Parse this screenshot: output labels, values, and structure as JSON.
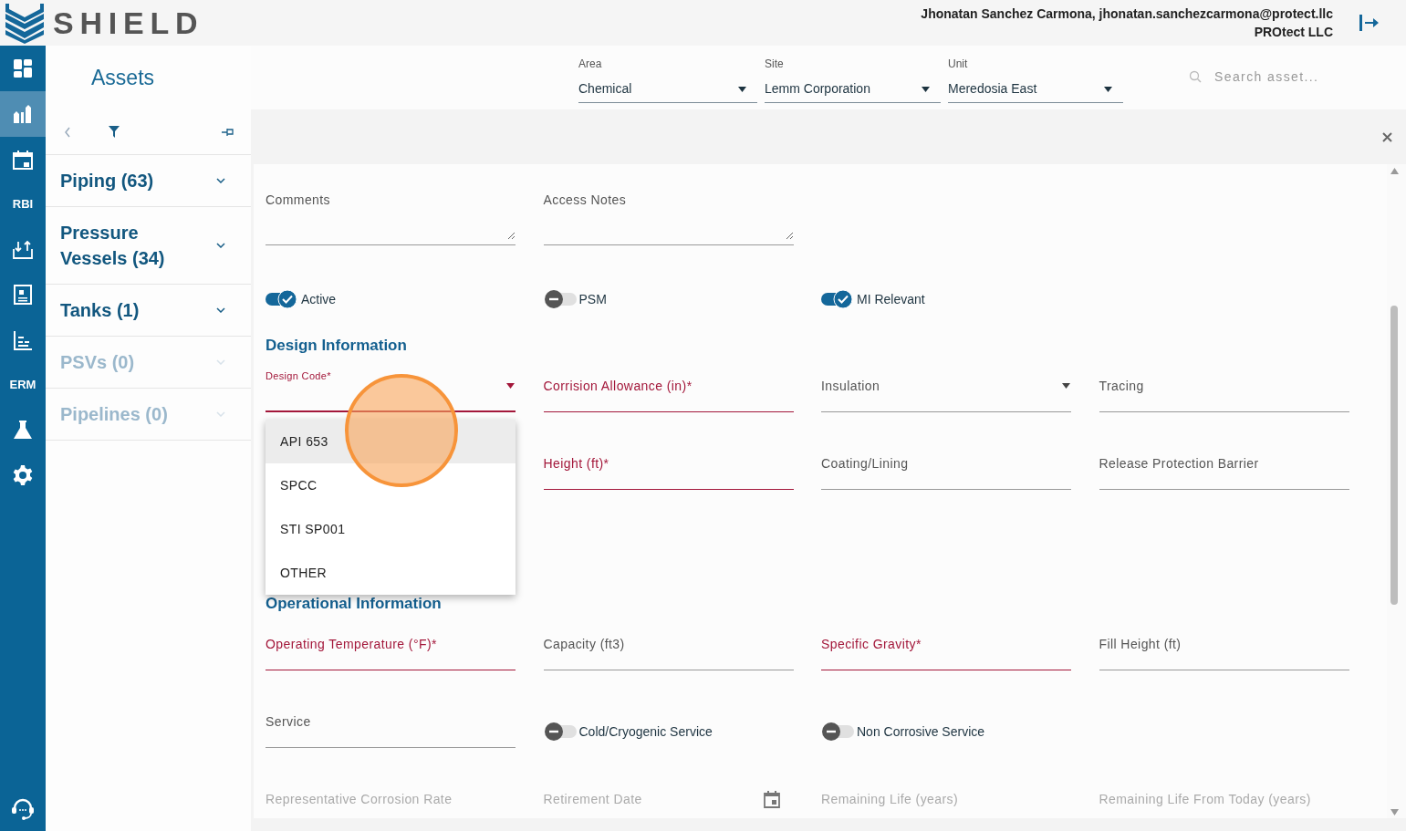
{
  "header": {
    "brand": "SHIELD",
    "user": "Jhonatan Sanchez Carmona, jhonatan.sanchezcarmona@protect.llc",
    "company": "PROtect LLC"
  },
  "rail": [
    {
      "kind": "icon",
      "selected": false
    },
    {
      "kind": "icon",
      "selected": true
    },
    {
      "kind": "icon",
      "selected": false
    },
    {
      "kind": "label",
      "text": "RBI"
    },
    {
      "kind": "icon",
      "selected": false
    },
    {
      "kind": "icon",
      "selected": false
    },
    {
      "kind": "icon",
      "selected": false
    },
    {
      "kind": "label",
      "text": "ERM"
    },
    {
      "kind": "icon",
      "selected": false
    },
    {
      "kind": "icon",
      "selected": false
    }
  ],
  "assets_panel": {
    "title": "Assets",
    "categories": [
      {
        "label": "Piping (63)",
        "disabled": false
      },
      {
        "label": "Pressure Vessels (34)",
        "disabled": false
      },
      {
        "label": "Tanks (1)",
        "disabled": false
      },
      {
        "label": "PSVs (0)",
        "disabled": true
      },
      {
        "label": "Pipelines (0)",
        "disabled": true
      }
    ]
  },
  "filters": [
    {
      "label": "Area",
      "value": "Chemical"
    },
    {
      "label": "Site",
      "value": "Lemm Corporation"
    },
    {
      "label": "Unit",
      "value": "Meredosia East"
    }
  ],
  "search": {
    "placeholder": "Search asset..."
  },
  "form": {
    "sections": [
      {
        "rows": [
          [
            {
              "kind": "textarea",
              "label": "Comments"
            },
            {
              "kind": "textarea",
              "label": "Access Notes"
            }
          ],
          [
            {
              "kind": "toggle",
              "label": "Active",
              "on": true
            },
            {
              "kind": "toggle",
              "label": "PSM",
              "on": false
            },
            {
              "kind": "toggle",
              "label": "MI Relevant",
              "on": true
            }
          ]
        ]
      },
      {
        "heading": "Design Information",
        "rows": [
          [
            {
              "kind": "select",
              "label": "Design Code*",
              "required": true,
              "open": true,
              "options": [
                {
                  "label": "API 653",
                  "highlighted": true
                },
                {
                  "label": "SPCC",
                  "highlighted": false
                },
                {
                  "label": "STI SP001",
                  "highlighted": false
                },
                {
                  "label": "OTHER",
                  "highlighted": false
                }
              ]
            },
            {
              "kind": "text",
              "label": "Corrision Allowance (in)*",
              "required": true
            },
            {
              "kind": "select",
              "label": "Insulation",
              "required": false,
              "open": false
            },
            {
              "kind": "text",
              "label": "Tracing",
              "required": false
            }
          ],
          [
            "",
            {
              "kind": "text",
              "label": "Height (ft)*",
              "required": true
            },
            {
              "kind": "text",
              "label": "Coating/Lining",
              "required": false
            },
            {
              "kind": "text",
              "label": "Release Protection Barrier",
              "required": false
            }
          ]
        ]
      },
      {
        "heading": "Operational Information",
        "rows": [
          [
            {
              "kind": "text",
              "label": "Operating Temperature (°F)*",
              "required": true
            },
            {
              "kind": "text",
              "label": "Capacity (ft3)",
              "required": false
            },
            {
              "kind": "text",
              "label": "Specific Gravity*",
              "required": true
            },
            {
              "kind": "text",
              "label": "Fill Height (ft)",
              "required": false
            }
          ],
          [
            {
              "kind": "text",
              "label": "Service",
              "required": false
            },
            {
              "kind": "toggle",
              "label": "Cold/Cryogenic Service",
              "on": false
            },
            {
              "kind": "toggle",
              "label": "Non Corrosive Service",
              "on": false
            }
          ],
          [
            {
              "kind": "text",
              "label": "Representative Corrosion Rate",
              "disabled": true
            },
            {
              "kind": "date",
              "label": "Retirement Date",
              "disabled": true
            },
            {
              "kind": "text",
              "label": "Remaining Life (years)",
              "disabled": true
            },
            {
              "kind": "text",
              "label": "Remaining Life From Today (years)",
              "disabled": true
            }
          ]
        ]
      }
    ]
  }
}
